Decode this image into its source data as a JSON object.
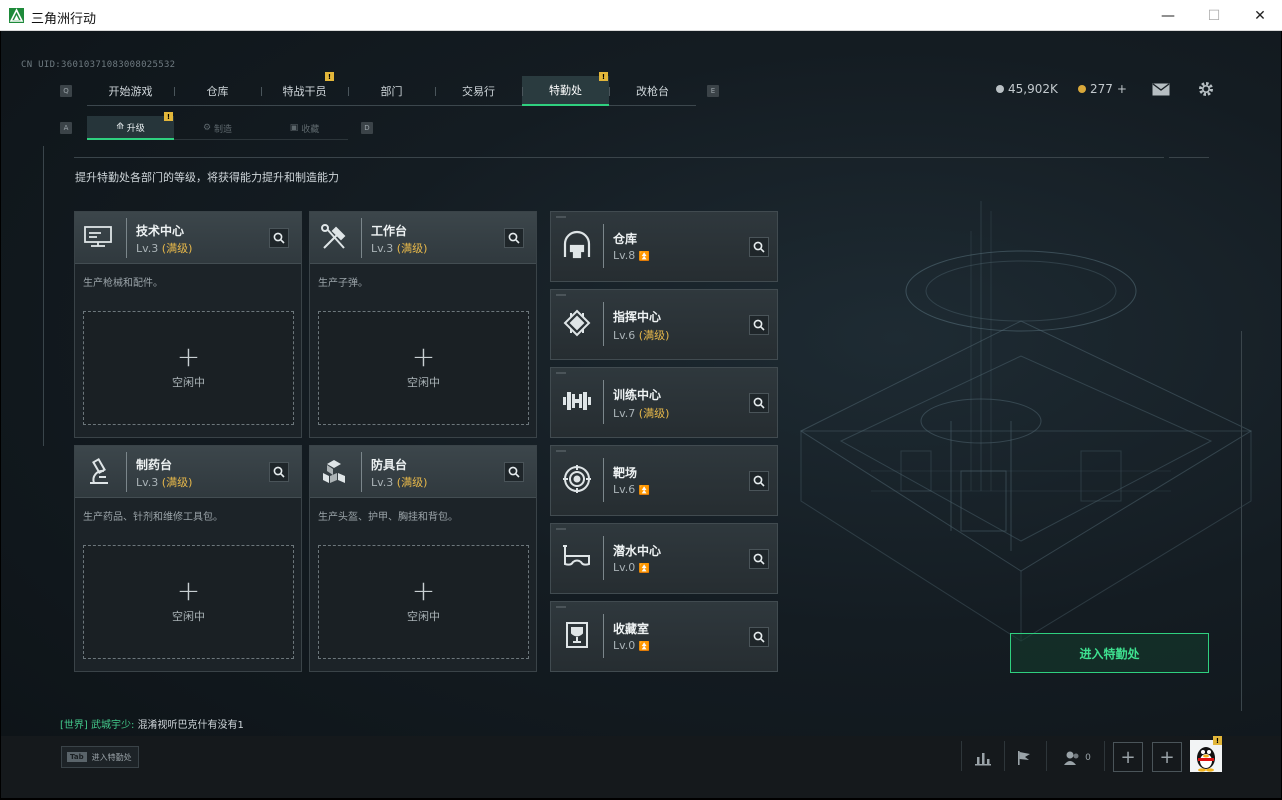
{
  "window": {
    "title": "三角洲行动"
  },
  "uid": "CN UID:36010371083008025532",
  "main_tabs": [
    {
      "label": "开始游戏",
      "badge": ""
    },
    {
      "label": "仓库",
      "badge": ""
    },
    {
      "label": "特战干员",
      "badge": "!"
    },
    {
      "label": "部门",
      "badge": ""
    },
    {
      "label": "交易行",
      "badge": ""
    },
    {
      "label": "特勤处",
      "badge": "!",
      "active": true
    },
    {
      "label": "改枪台",
      "badge": ""
    }
  ],
  "key_hints": {
    "left_main": "Q",
    "right_main": "E",
    "left_sub": "A",
    "right_sub": "D"
  },
  "sub_tabs": [
    {
      "label": "升级",
      "badge": "!",
      "active": true
    },
    {
      "label": "制造"
    },
    {
      "label": "收藏"
    }
  ],
  "currency": {
    "coins": "45,902K",
    "premium": "277",
    "plus": "+"
  },
  "description": "提升特勤处各部门的等级，将获得能力提升和制造能力",
  "workstations": [
    {
      "name": "技术中心",
      "level": "Lv.3",
      "max": "(满级)",
      "desc": "生产枪械和配件。",
      "icon": "computer-icon",
      "plus": "+",
      "slot": "空闲中"
    },
    {
      "name": "工作台",
      "level": "Lv.3",
      "max": "(满级)",
      "desc": "生产子弹。",
      "icon": "tools-icon",
      "plus": "+",
      "slot": "空闲中"
    },
    {
      "name": "制药台",
      "level": "Lv.3",
      "max": "(满级)",
      "desc": "生产药品、针剂和维修工具包。",
      "icon": "microscope-icon",
      "plus": "+",
      "slot": "空闲中"
    },
    {
      "name": "防具台",
      "level": "Lv.3",
      "max": "(满级)",
      "desc": "生产头盔、护甲、胸挂和背包。",
      "icon": "cubes-icon",
      "plus": "+",
      "slot": "空闲中"
    }
  ],
  "facilities": [
    {
      "name": "仓库",
      "level": "Lv.8",
      "max": "",
      "upgradable": true,
      "icon": "warehouse-icon"
    },
    {
      "name": "指挥中心",
      "level": "Lv.6",
      "max": "(满级)",
      "upgradable": false,
      "icon": "chip-icon"
    },
    {
      "name": "训练中心",
      "level": "Lv.7",
      "max": "(满级)",
      "upgradable": false,
      "icon": "dumbbell-icon"
    },
    {
      "name": "靶场",
      "level": "Lv.6",
      "max": "",
      "upgradable": true,
      "icon": "target-icon"
    },
    {
      "name": "潜水中心",
      "level": "Lv.0",
      "max": "",
      "upgradable": true,
      "icon": "diving-mask-icon"
    },
    {
      "name": "收藏室",
      "level": "Lv.0",
      "max": "",
      "upgradable": true,
      "icon": "trophy-icon"
    }
  ],
  "enter_button": "进入特勤处",
  "chat": {
    "channel": "[世界]",
    "user": "武城宇少:",
    "message": "混淆视听巴克什有没有1"
  },
  "tab_hint": {
    "key": "Tab",
    "label": "进入特勤处"
  },
  "friends_count": "0",
  "avatar_badge": "!",
  "colors": {
    "accent": "#2fd07f",
    "max_level": "#e7b84a",
    "badge": "#e2b63a"
  }
}
